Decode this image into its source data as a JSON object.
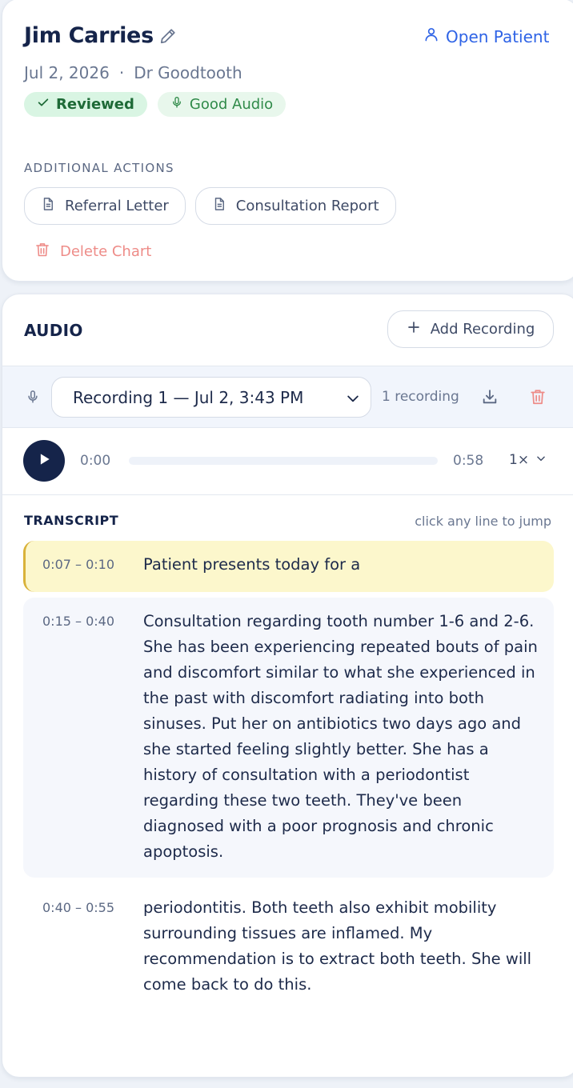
{
  "patient": {
    "name": "Jim Carries",
    "open_label": "Open Patient",
    "date": "Jul 2, 2026",
    "separator": "·",
    "doctor": "Dr Goodtooth"
  },
  "badges": {
    "reviewed": "Reviewed",
    "audio": "Good Audio"
  },
  "actions": {
    "caption": "ADDITIONAL ACTIONS",
    "referral": "Referral Letter",
    "consultation": "Consultation Report",
    "delete": "Delete Chart"
  },
  "audio": {
    "title": "AUDIO",
    "add_label": "Add Recording",
    "selected_recording": "Recording 1 — Jul 2, 3:43 PM",
    "count": "1 recording",
    "current_time": "0:00",
    "total_time": "0:58",
    "progress": 0,
    "speed": "1×"
  },
  "transcript": {
    "title": "TRANSCRIPT",
    "hint": "click any line to jump",
    "lines": [
      {
        "time": "0:07 – 0:10",
        "text": "Patient presents today for a"
      },
      {
        "time": "0:15 – 0:40",
        "text": "Consultation regarding tooth number 1-6 and 2-6. She has been experiencing repeated bouts of pain and discomfort similar to what she experienced in the past with discomfort radiating into both sinuses. Put her on antibiotics two days ago and she started feeling slightly better. She has a history of consultation with a periodontist regarding these two teeth. They've been diagnosed with a poor prognosis and chronic apoptosis."
      },
      {
        "time": "0:40 – 0:55",
        "text": "periodontitis. Both teeth also exhibit mobility surrounding tissues are inflamed. My recommendation is to extract both teeth. She will come back to do this."
      }
    ]
  },
  "colors": {
    "accent": "#2e63e6",
    "navy": "#15244a",
    "reviewed_bg": "#d9f5e3",
    "delete": "#ee8c88",
    "highlight": "#fcf7cc"
  },
  "icons": {
    "edit": "pencil-icon",
    "open_patient": "person-icon",
    "reviewed": "check-icon",
    "audio": "microphone-icon",
    "document": "document-icon",
    "delete": "trash-icon",
    "add": "plus-icon",
    "download": "download-icon",
    "dropdown": "chevron-down-icon",
    "play": "play-icon"
  }
}
